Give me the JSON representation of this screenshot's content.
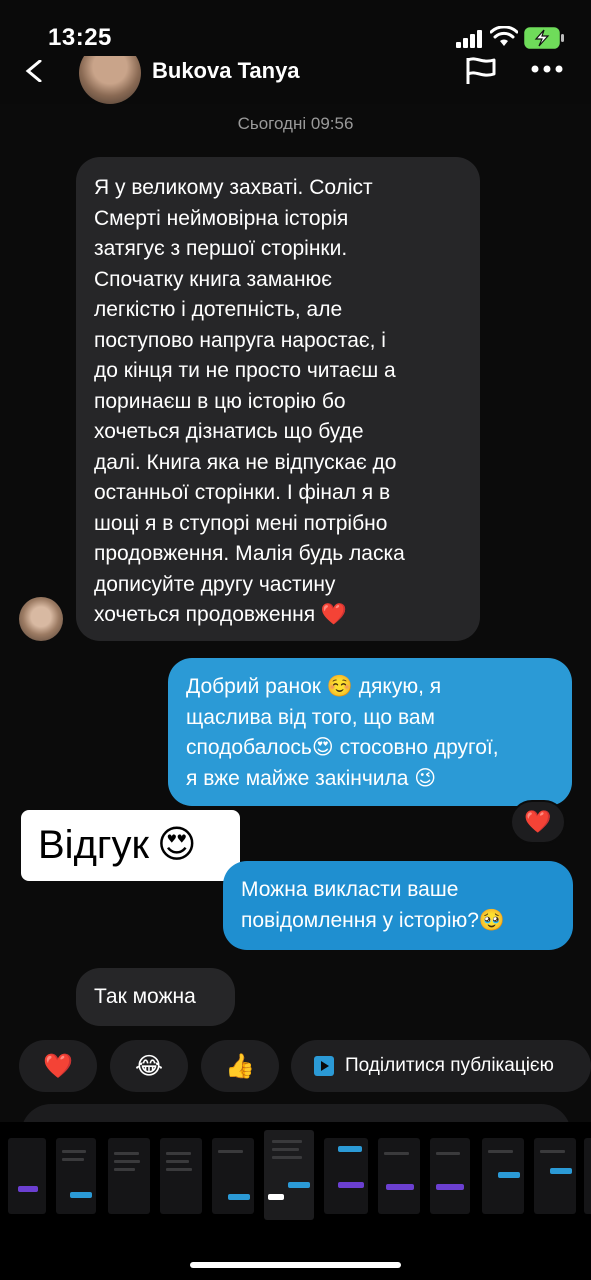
{
  "status_bar": {
    "time": "13:25"
  },
  "header": {
    "contact_name": "Bukova Tanya"
  },
  "chat": {
    "date_separator": "Сьогодні 09:56",
    "incoming_1": {
      "lines": [
        "Я у великому захваті. Соліст",
        "Смерті неймовірна історія",
        "затягує з першої сторінки.",
        "Спочатку книга заманює",
        "легкістю і дотепність, але",
        "поступово напруга наростає, і",
        "до кінця ти не просто читаєш а",
        "поринаєш в цю історію бо",
        "хочеться дізнатись що буде",
        "далі. Книга яка не відпускає до",
        "останньої сторінки. І фінал я в",
        "шоці я в ступорі мені потрібно",
        "продовження. Малія будь ласка",
        "дописуйте другу частину",
        "хочеться продовження ❤️"
      ]
    },
    "outgoing_1": {
      "lines": [
        "Добрий ранок ☺️ дякую, я",
        "щаслива від того, що вам",
        "сподобалось😍 стосовно другої,",
        "я вже майже закінчила 😉"
      ],
      "reaction": "❤️"
    },
    "outgoing_2": {
      "lines": [
        "Можна викласти ваше",
        "повідомлення у історію?🥹"
      ]
    },
    "incoming_2": {
      "text": "Так можна"
    }
  },
  "overlay_label": {
    "text": "Відгук",
    "emoji": "😍"
  },
  "quick_reactions": [
    {
      "emoji": "❤️"
    },
    {
      "emoji": "😂"
    },
    {
      "emoji": "👍"
    }
  ],
  "share_button": {
    "label": "Поділитися публікацією"
  },
  "colors": {
    "incoming_bubble": "#262628",
    "outgoing_bubble": "#2b9ad6",
    "background": "#0b0b0b"
  }
}
